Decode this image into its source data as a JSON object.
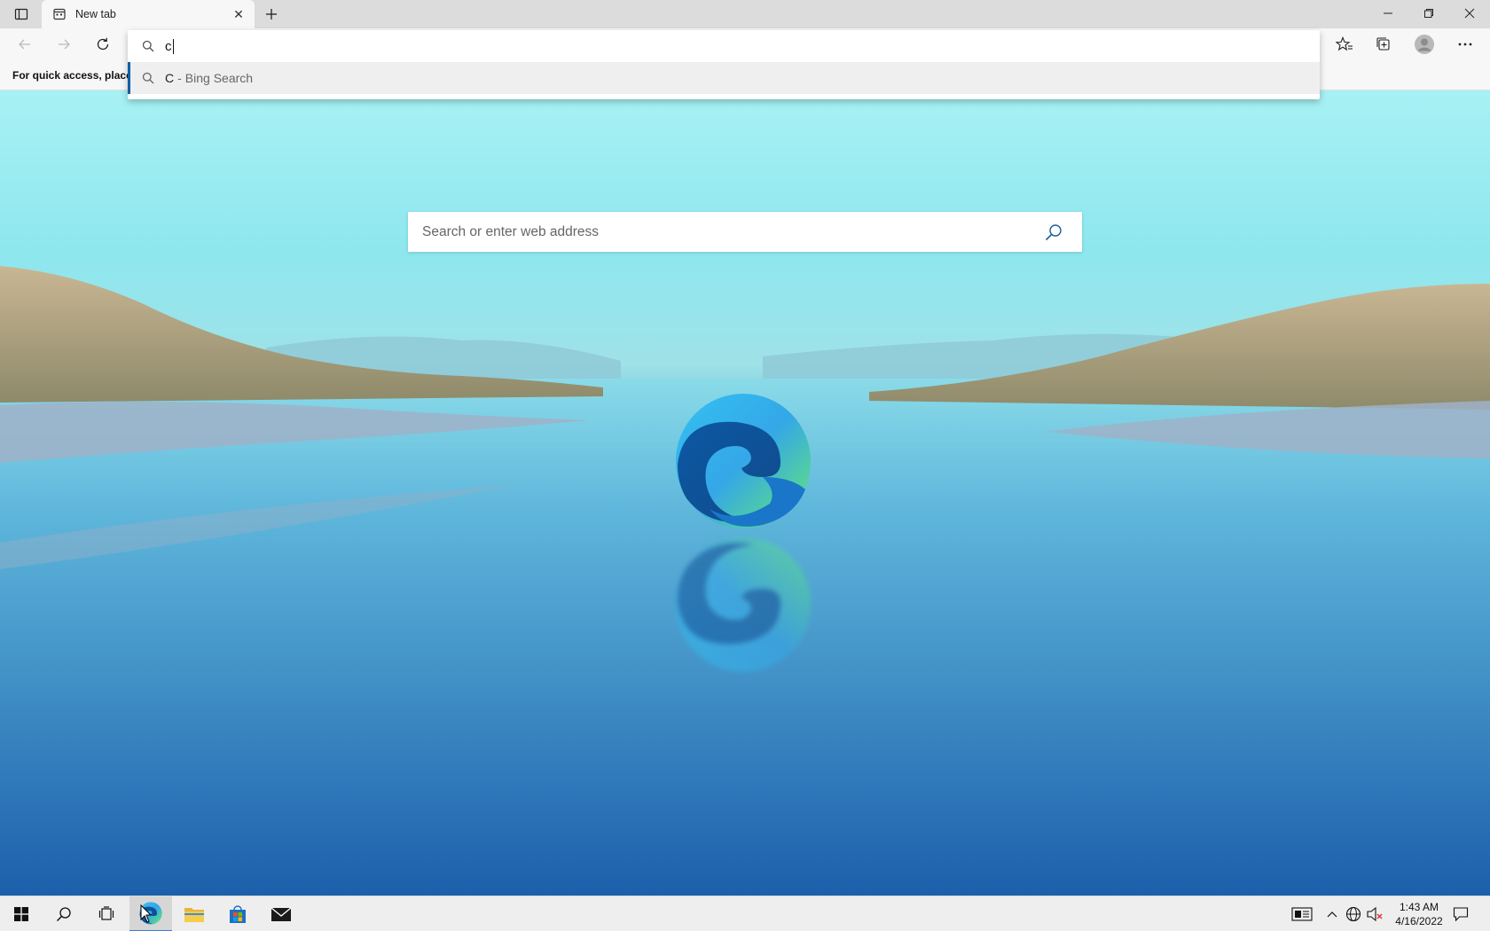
{
  "browser": {
    "tab": {
      "title": "New tab",
      "close_glyph": "✕"
    },
    "new_tab_glyph": "+",
    "favorites_bar_text": "For quick access, place y",
    "omnibox": {
      "value": "c",
      "suggestion": {
        "query": "C",
        "separator": "-",
        "engine": "Bing Search"
      }
    }
  },
  "page": {
    "search_placeholder": "Search or enter web address"
  },
  "taskbar": {
    "clock_time": "1:43 AM",
    "clock_date": "4/16/2022"
  },
  "icons": [
    "tab-actions-icon",
    "new-tab-page-icon",
    "close-icon",
    "plus-icon",
    "minimize-icon",
    "restore-icon",
    "back-icon",
    "forward-icon",
    "refresh-icon",
    "favorites-icon",
    "collections-icon",
    "profile-icon",
    "more-icon",
    "search-icon",
    "edge-logo-icon",
    "windows-start-icon",
    "task-view-icon",
    "file-explorer-icon",
    "store-icon",
    "mail-icon",
    "news-icon",
    "chevron-up-icon",
    "network-icon",
    "volume-icon",
    "notification-icon"
  ],
  "colors": {
    "accent": "#0f5fa8",
    "taskbar": "#eeeeee",
    "tabstrip": "#dcdcdc"
  }
}
